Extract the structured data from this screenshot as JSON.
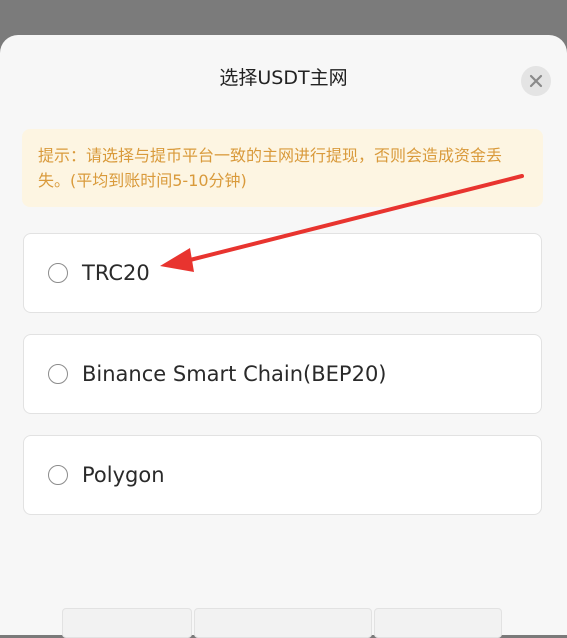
{
  "dialog": {
    "title": "选择USDT主网",
    "notice": "提示：请选择与提币平台一致的主网进行提现，否则会造成资金丢失。(平均到账时间5-10分钟)"
  },
  "options": [
    {
      "label": "TRC20",
      "selected": false
    },
    {
      "label": "Binance Smart Chain(BEP20)",
      "selected": false
    },
    {
      "label": "Polygon",
      "selected": false
    }
  ],
  "icons": {
    "close": "close-icon",
    "radio": "radio-icon"
  },
  "colors": {
    "notice_bg": "#fdf5e2",
    "notice_text": "#d99a3b",
    "annotation_arrow": "#e8342f"
  }
}
